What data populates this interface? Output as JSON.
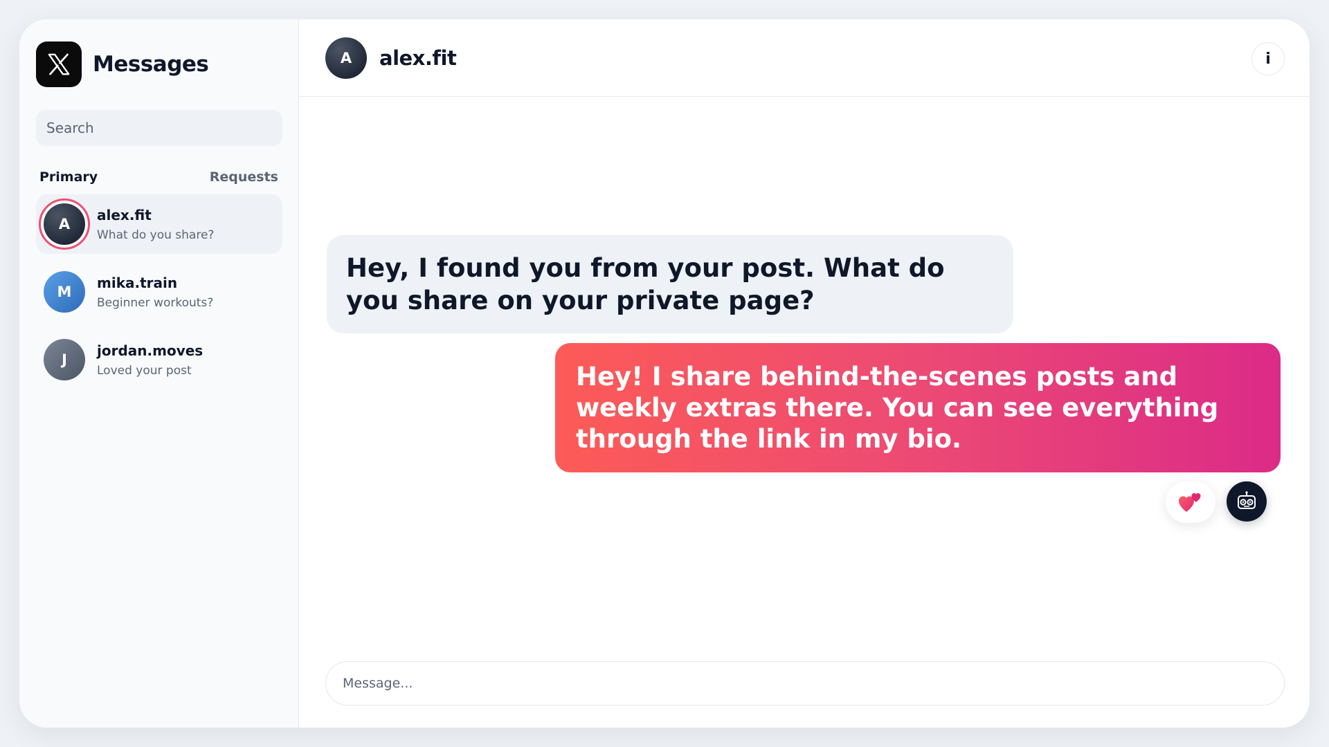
{
  "app": {
    "title": "Messages",
    "logo": "x-logo-icon"
  },
  "search": {
    "placeholder": "Search"
  },
  "tabs": {
    "primary": "Primary",
    "requests": "Requests"
  },
  "conversations": [
    {
      "name": "alex.fit",
      "preview": "What do you share?",
      "initial": "A",
      "active": true
    },
    {
      "name": "mika.train",
      "preview": "Beginner workouts?",
      "initial": "M",
      "active": false
    },
    {
      "name": "jordan.moves",
      "preview": "Loved your post",
      "initial": "J",
      "active": false
    }
  ],
  "chat": {
    "name": "alex.fit",
    "initial": "A",
    "info_label": "i",
    "messages": [
      {
        "direction": "incoming",
        "text": "Hey, I found you from your post. What do you share on your private page?"
      },
      {
        "direction": "outgoing",
        "text": "Hey! I share behind-the-scenes posts and weekly extras there. You can see everything through the link in my bio."
      }
    ],
    "reaction_icon": "hearts-icon",
    "assistant_icon": "robot-icon"
  },
  "composer": {
    "placeholder": "Message..."
  },
  "colors": {
    "accent_gradient_start": "#fc5b57",
    "accent_gradient_end": "#db2b87",
    "ring": "#ec4f72"
  }
}
